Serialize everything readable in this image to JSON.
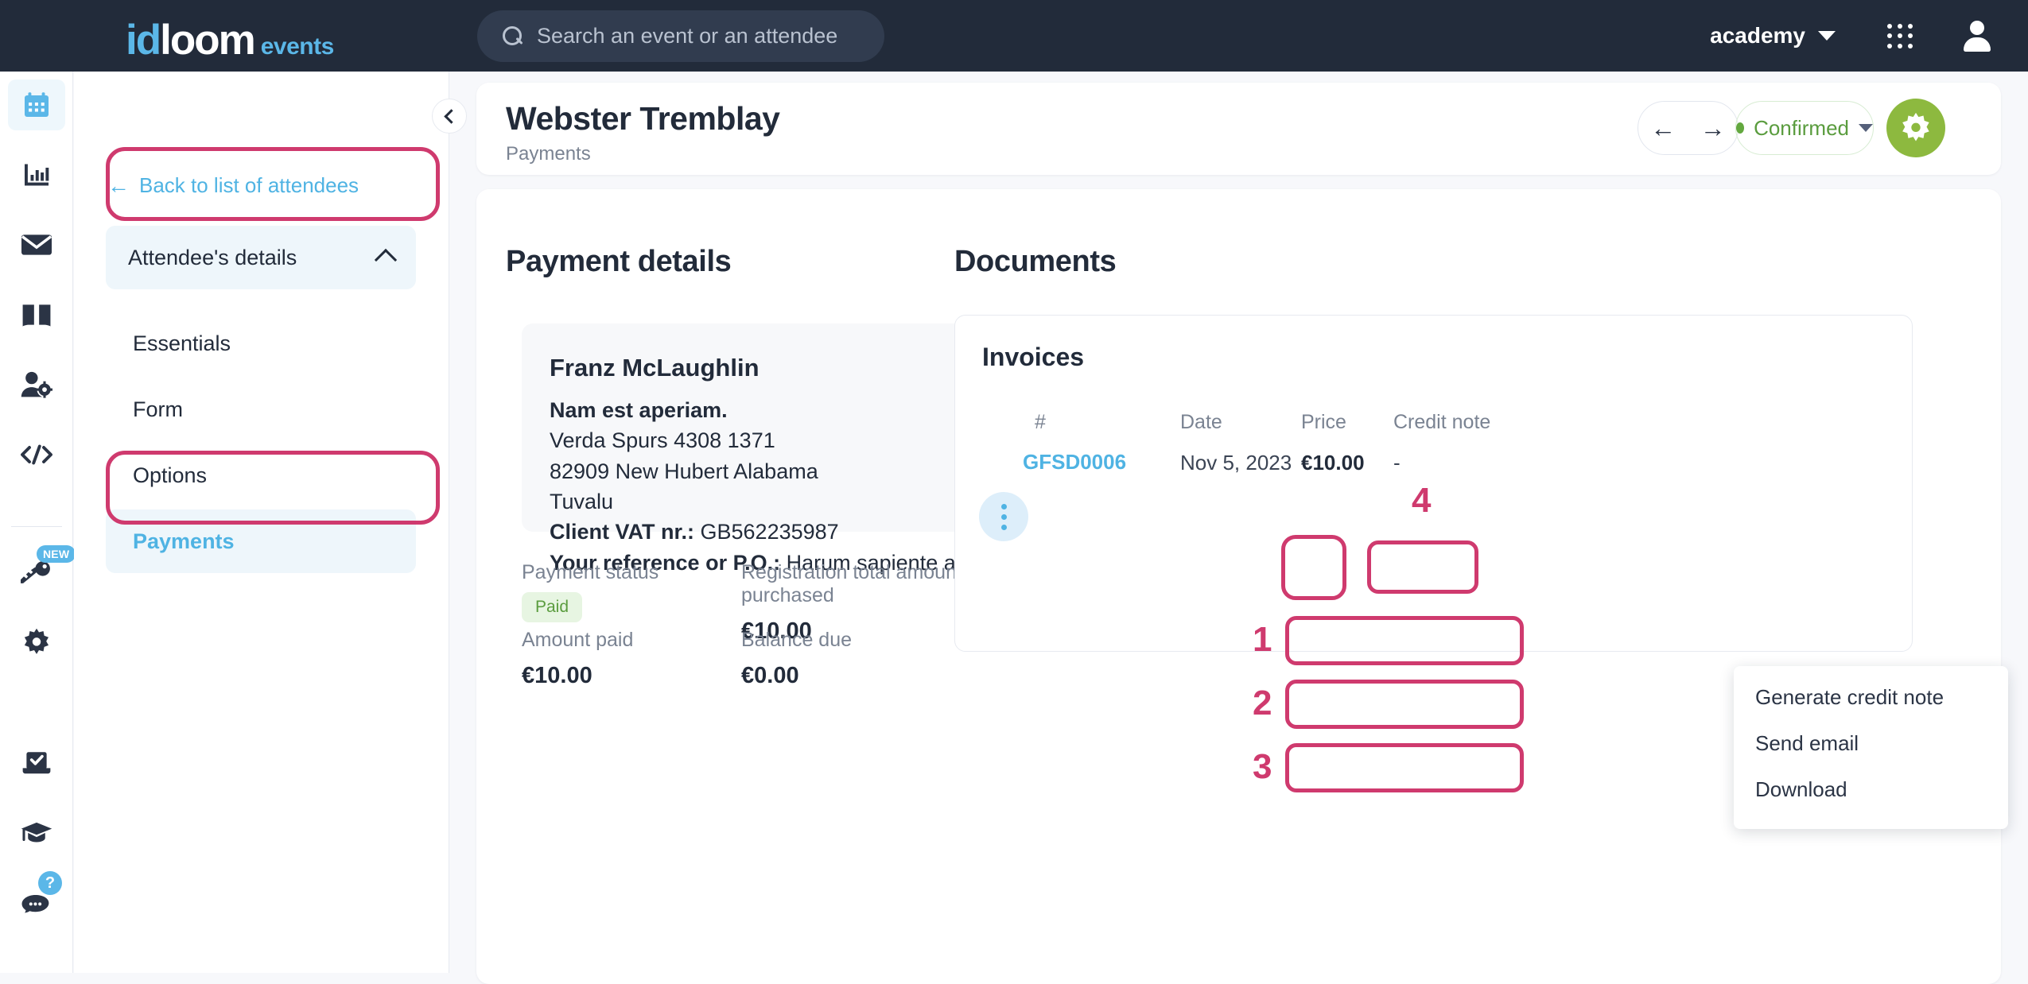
{
  "topbar": {
    "logo": {
      "part1": "id",
      "part2": "loom",
      "part3": "events"
    },
    "search": {
      "placeholder": "Search an event or an attendee",
      "icon": "search-icon"
    },
    "account": {
      "name": "academy",
      "caret": "chevron-down-icon"
    },
    "apps_icon": "grid-apps-icon",
    "user_icon": "user-avatar-icon"
  },
  "rail": {
    "items": [
      {
        "name": "calendar-icon",
        "active": true
      },
      {
        "name": "statistics-icon",
        "active": false
      },
      {
        "name": "mail-icon",
        "active": false
      },
      {
        "name": "book-icon",
        "active": false
      },
      {
        "name": "user-settings-icon",
        "active": false
      },
      {
        "name": "code-icon",
        "active": false
      },
      {
        "name": "key-icon",
        "active": false,
        "badge": "NEW"
      },
      {
        "name": "gear-icon",
        "active": false
      },
      {
        "name": "checkin-icon",
        "active": false
      },
      {
        "name": "graduation-cap-icon",
        "active": false
      },
      {
        "name": "chat-help-icon",
        "active": false,
        "badge": "?"
      }
    ]
  },
  "nav": {
    "back_label": "Back to list of attendees",
    "back_icon": "arrow-left-icon",
    "group_label": "Attendee's details",
    "group_chevron": "chevron-up-icon",
    "items": [
      {
        "label": "Essentials",
        "active": false
      },
      {
        "label": "Form",
        "active": false
      },
      {
        "label": "Options",
        "active": false
      },
      {
        "label": "Payments",
        "active": true
      }
    ],
    "collapse_icon": "chevron-left-icon"
  },
  "header": {
    "title": "Webster Tremblay",
    "subtitle": "Payments",
    "prev_icon": "arrow-left-icon",
    "next_icon": "arrow-right-icon",
    "status": {
      "label": "Confirmed",
      "color": "#5a9c3e",
      "caret": "chevron-down-icon"
    },
    "gear_icon": "gear-icon"
  },
  "payment": {
    "section_title": "Payment details",
    "billing": {
      "name": "Franz McLaughlin",
      "company": "Nam est aperiam.",
      "street": "Verda Spurs 4308 1371",
      "city": "82909 New Hubert Alabama",
      "country": "Tuvalu",
      "vat_label": "Client VAT nr.:",
      "vat_value": "GB562235987",
      "ref_label": "Your reference or P.O.:",
      "ref_value": "Harum sapiente a itaque sit id est."
    },
    "fields": {
      "status_label": "Payment status",
      "status_value": "Paid",
      "total_label": "Registration total amount purchased",
      "total_value": "€10.00",
      "paid_label": "Amount paid",
      "paid_value": "€10.00",
      "balance_label": "Balance due",
      "balance_value": "€0.00"
    }
  },
  "documents": {
    "section_title": "Documents",
    "invoices": {
      "title": "Invoices",
      "columns": [
        "#",
        "Date",
        "Price",
        "Credit note"
      ],
      "rows": [
        {
          "number": "GFSD0006",
          "date": "Nov 5, 2023",
          "price": "€10.00",
          "credit_note": "-",
          "menu_icon": "kebab-menu-icon"
        }
      ]
    },
    "menu": {
      "items": [
        {
          "label": "Generate credit note"
        },
        {
          "label": "Send email"
        },
        {
          "label": "Download"
        }
      ]
    }
  },
  "annotations": {
    "numbers": [
      "1",
      "2",
      "3",
      "4"
    ],
    "color": "#cf3a6e"
  }
}
